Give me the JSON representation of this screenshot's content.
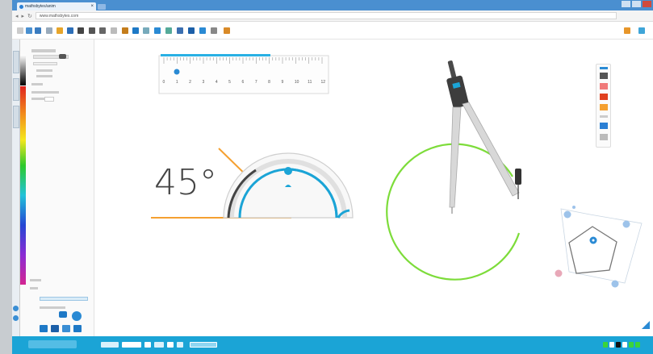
{
  "browser": {
    "tab_title": "mathsbytes/anim",
    "url": "www.mathsbytes.com"
  },
  "canvas": {
    "angle_text": "45°",
    "ruler_ticks": [
      "0",
      "1",
      "2",
      "3",
      "4",
      "5",
      "6",
      "7",
      "8",
      "9",
      "10",
      "11",
      "12"
    ]
  },
  "colors": {
    "titlebar": "#4a8fd0",
    "statusbar": "#1ba4d6",
    "accent": "#1ba4d6",
    "circle": "#7ddc3a",
    "orange": "#f5a030"
  },
  "icons": {
    "back": "arrow-left-icon",
    "forward": "arrow-right-icon",
    "reload": "reload-icon",
    "settings": "settings-icon"
  }
}
